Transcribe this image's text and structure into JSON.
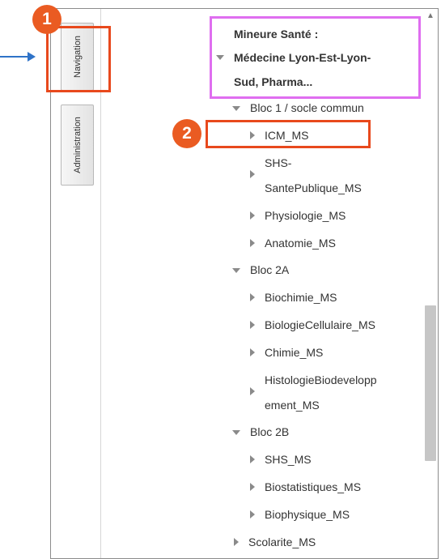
{
  "tabs": {
    "navigation": "Navigation",
    "administration": "Administration"
  },
  "tree": {
    "root_line1": "Mineure Santé :",
    "root_line2": "Médecine Lyon-Est-Lyon-",
    "root_line3": "Sud, Pharma...",
    "bloc1": {
      "label": "Bloc 1 / socle commun",
      "items": [
        "ICM_MS",
        "SHS-",
        "SantePublique_MS",
        "Physiologie_MS",
        "Anatomie_MS"
      ]
    },
    "bloc2a": {
      "label": "Bloc 2A",
      "items": [
        "Biochimie_MS",
        "BiologieCellulaire_MS",
        "Chimie_MS",
        "HistologieBiodevelopp",
        "ement_MS"
      ]
    },
    "bloc2b": {
      "label": "Bloc 2B",
      "items": [
        "SHS_MS",
        "Biostatistiques_MS",
        "Biophysique_MS"
      ]
    },
    "scolarite": "Scolarite_MS"
  },
  "annotations": {
    "badge1": "1",
    "badge2": "2",
    "colors": {
      "badge": "#ea5b22",
      "box_red": "#e8491d",
      "box_pink": "#df6ef0",
      "arrow": "#2f73c8"
    }
  },
  "icons": {
    "scroll_up": "▲"
  }
}
